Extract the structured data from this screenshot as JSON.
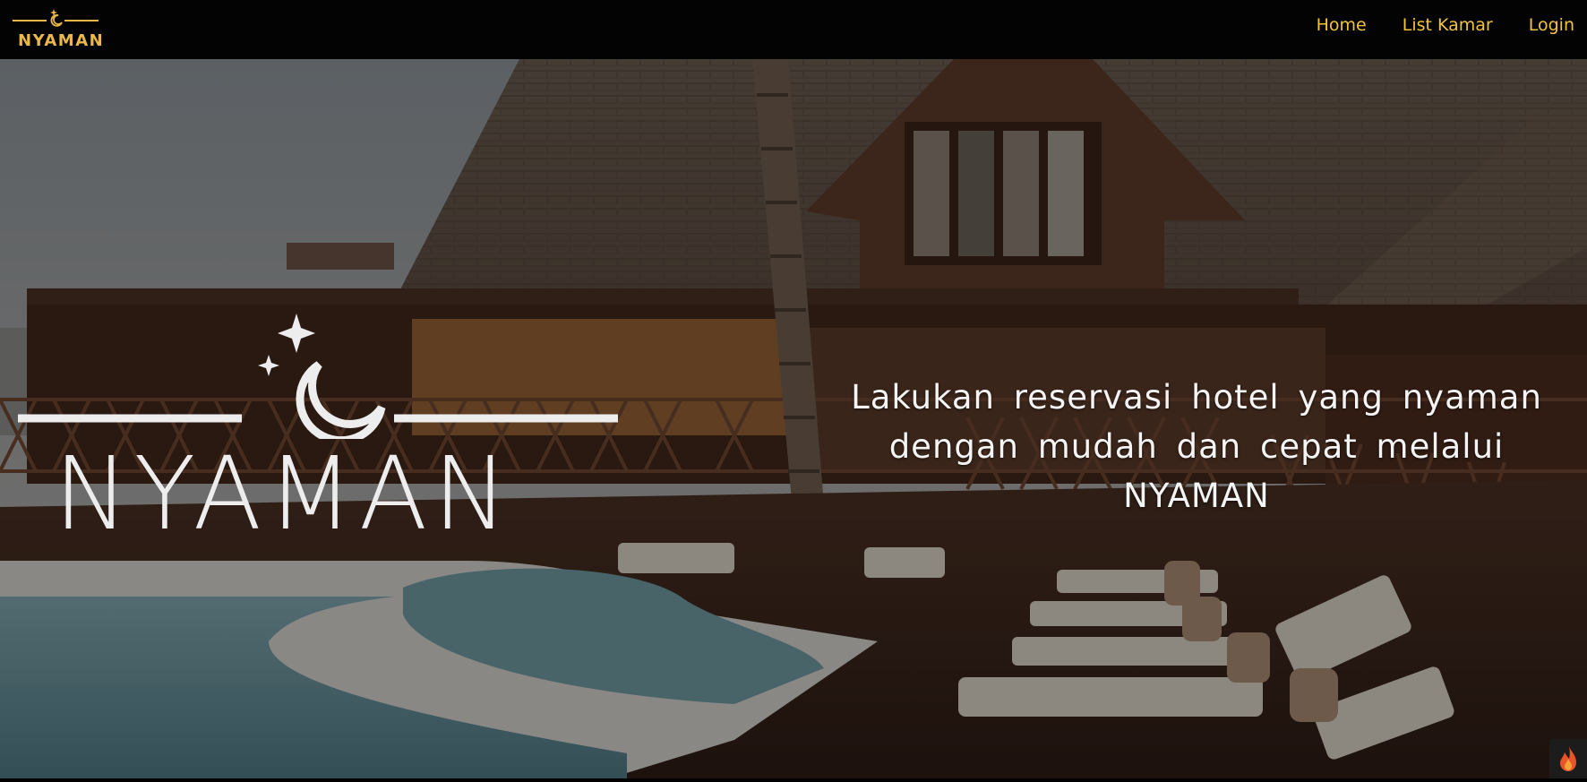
{
  "navbar": {
    "brand_text": "NYAMAN",
    "brand_icon": "moon-star-icon",
    "links": [
      {
        "label": "Home"
      },
      {
        "label": "List Kamar"
      },
      {
        "label": "Login"
      }
    ]
  },
  "hero": {
    "logo_text": "NYAMAN",
    "logo_icon": "moon-star-icon",
    "tagline": "Lakukan reservasi hotel yang nyaman dengan mudah dan cepat melalui NYAMAN"
  },
  "widget": {
    "icon": "flame-icon"
  },
  "colors": {
    "navbar_bg": "#030303",
    "nav_link": "#f2c33c",
    "brand_gold": "#e8b84a",
    "hero_text": "#f4f4f4",
    "logo_white": "#ededed"
  }
}
